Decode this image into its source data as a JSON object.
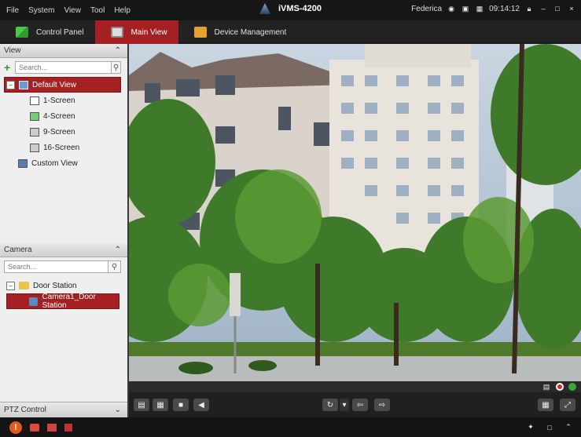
{
  "menu": [
    "File",
    "System",
    "View",
    "Tool",
    "Help"
  ],
  "app_title": "iVMS-4200",
  "user": "Federica",
  "time": "09:14:12",
  "tabs": [
    {
      "label": "Control Panel",
      "active": false
    },
    {
      "label": "Main View",
      "active": true
    },
    {
      "label": "Device Management",
      "active": false
    }
  ],
  "view_panel": {
    "title": "View",
    "search_placeholder": "Search...",
    "items": [
      {
        "label": "Default View",
        "selected": true
      },
      {
        "label": "1-Screen"
      },
      {
        "label": "4-Screen"
      },
      {
        "label": "9-Screen"
      },
      {
        "label": "16-Screen"
      },
      {
        "label": "Custom View"
      }
    ]
  },
  "camera_panel": {
    "title": "Camera",
    "search_placeholder": "Search...",
    "group": "Door Station",
    "camera": "Camera1_Door Station"
  },
  "ptz_panel": {
    "title": "PTZ Control"
  },
  "colors": {
    "accent": "#a52022",
    "bg_dark": "#1b1b1b",
    "panel": "#efefef"
  }
}
